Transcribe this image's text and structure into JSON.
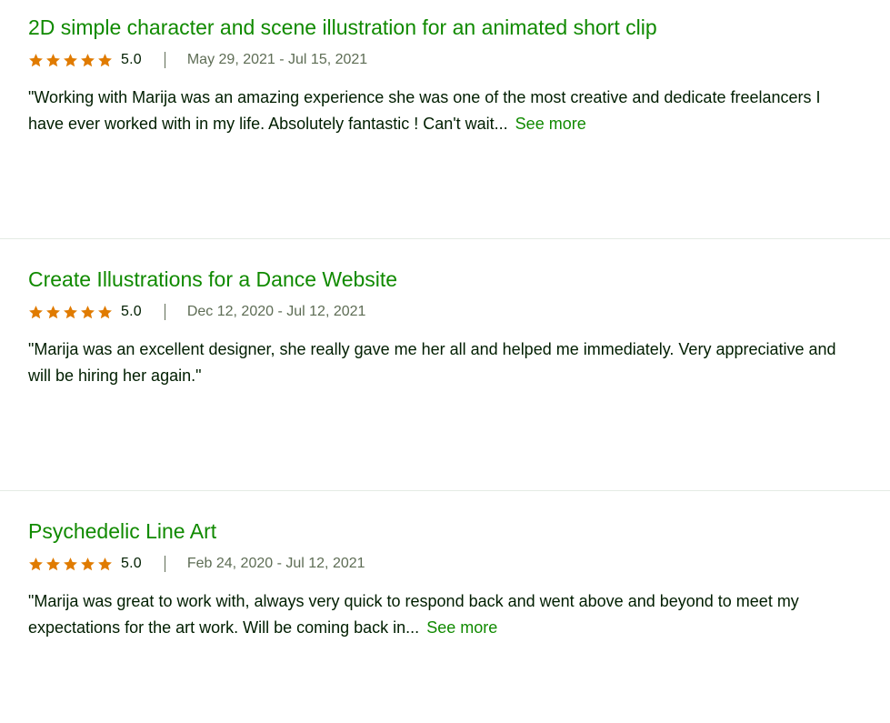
{
  "reviews": [
    {
      "title": "2D simple character and scene illustration for an animated short clip",
      "rating": "5.0",
      "stars": 5,
      "dates": "May 29, 2021 - Jul 15, 2021",
      "quote_line1": "\"Working with Marija was an amazing experience she was one of the most creative and dedicate freelancers I",
      "quote_line2": "have ever worked with in my life. Absolutely fantastic ! Can't wait...",
      "see_more": "See more"
    },
    {
      "title": "Create Illustrations for a Dance Website",
      "rating": "5.0",
      "stars": 5,
      "dates": "Dec 12, 2020 - Jul 12, 2021",
      "quote_line1": "\"Marija was an excellent designer, she really gave me her all and helped me immediately. Very appreciative and",
      "quote_line2": "will be hiring her again.\"",
      "see_more": ""
    },
    {
      "title": "Psychedelic Line Art",
      "rating": "5.0",
      "stars": 5,
      "dates": "Feb 24, 2020 - Jul 12, 2021",
      "quote_line1": "\"Marija was great to work with, always very quick to respond back and went above and beyond to meet my",
      "quote_line2": "expectations for the art work. Will be coming back in...",
      "see_more": "See more"
    }
  ],
  "colors": {
    "title_green": "#108a00",
    "star_orange": "#e07b00",
    "text_dark": "#001e00",
    "text_muted": "#5e6d55",
    "divider": "#e4ebe4"
  },
  "icons": {
    "star": "star-icon"
  }
}
